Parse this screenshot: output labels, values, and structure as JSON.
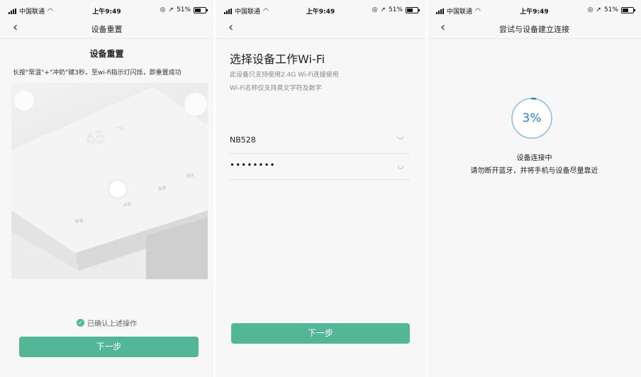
{
  "status_bar": {
    "carrier": "中国联通",
    "time": "上午9:49",
    "battery": "51%",
    "icons": [
      "signal-icon",
      "wifi-icon",
      "lock-rotation-icon",
      "location-arrow-icon",
      "battery-icon"
    ]
  },
  "screen1": {
    "nav_title": "设备重置",
    "heading": "设备重置",
    "description": "长按\"常温\"+\"冲奶\"键3秒，至wi-fi指示灯闪烁，即重置成功",
    "device_photo": {
      "display": "45",
      "display_unit": "°C",
      "labels": [
        "常温",
        "冲奶",
        "泡茶",
        "洗水"
      ]
    },
    "confirm_text": "已确认上述操作",
    "next_button": "下一步"
  },
  "screen2": {
    "heading": "选择设备工作Wi-Fi",
    "tip1": "此设备只支持使用2.4G Wi-Fi连接使用",
    "tip2": "Wi-Fi名称仅支持英文字符及数字",
    "wifi_name": "NB528",
    "password_masked": "••••••••",
    "next_button": "下一步"
  },
  "screen3": {
    "nav_title": "尝试与设备建立连接",
    "progress_text": "3%",
    "progress_fraction": 0.03,
    "status_line1": "设备连接中",
    "status_line2": "请勿断开蓝牙，并将手机与设备尽量靠近"
  },
  "colors": {
    "accent": "#53b797",
    "progress": "#2f7fc0",
    "background": "#f7f7f7"
  }
}
